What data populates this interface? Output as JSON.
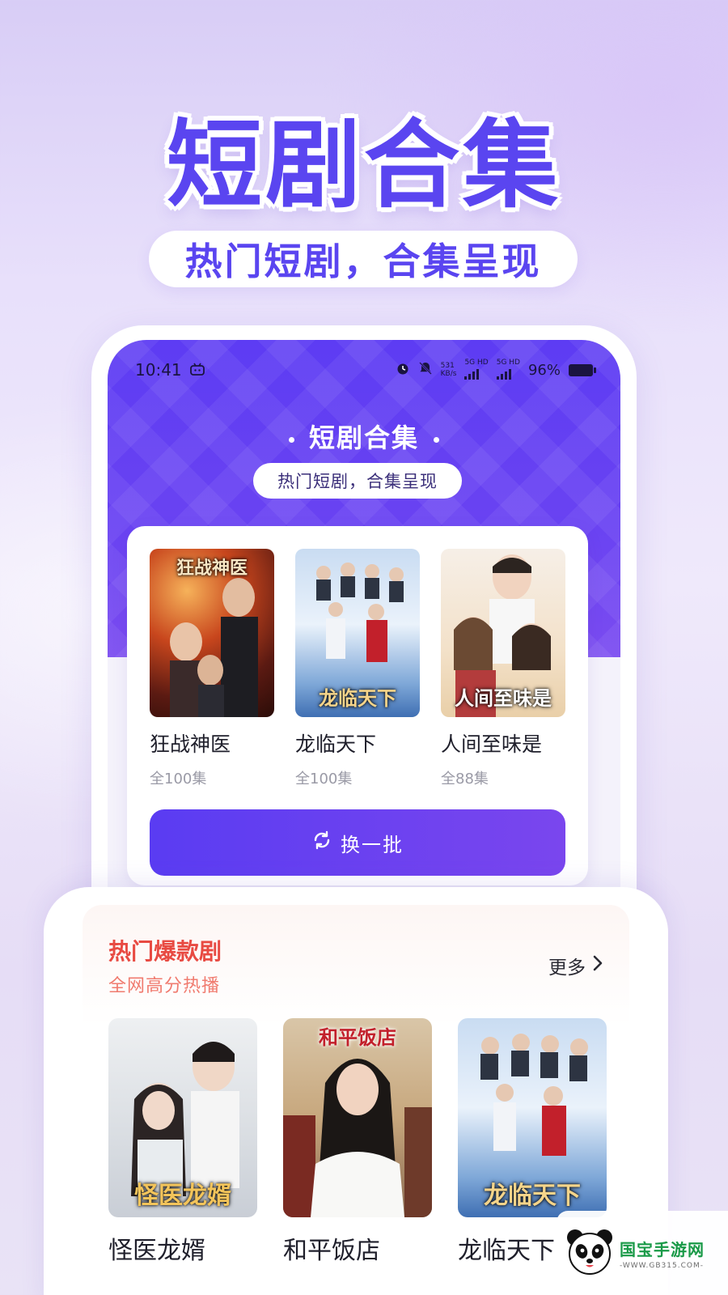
{
  "hero": {
    "title": "短剧合集",
    "subtitle": "热门短剧，合集呈现"
  },
  "status_bar": {
    "time": "10:41",
    "net_speed_value": "531",
    "net_speed_unit": "KB/s",
    "sim1": "5G HD",
    "sim2": "5G HD",
    "battery": "96%"
  },
  "screen": {
    "title": "短剧合集",
    "subtitle": "热门短剧，合集呈现",
    "dramas": [
      {
        "name": "狂战神医",
        "episodes": "全100集",
        "poster_caption": "狂战神医"
      },
      {
        "name": "龙临天下",
        "episodes": "全100集",
        "poster_caption": "龙临天下"
      },
      {
        "name": "人间至味是",
        "episodes": "全88集",
        "poster_caption": "人间至味是"
      }
    ],
    "refresh_label": "换一批"
  },
  "hot": {
    "title": "热门爆款剧",
    "subtitle": "全网高分热播",
    "more_label": "更多",
    "items": [
      {
        "name": "怪医龙婿",
        "poster_caption": "怪医龙婿"
      },
      {
        "name": "和平饭店",
        "poster_caption": "和平饭店"
      },
      {
        "name": "龙临天下",
        "poster_caption": "龙临天下"
      }
    ]
  },
  "watermark": {
    "name": "国宝手游网",
    "url": "-WWW.GB315.COM-"
  },
  "colors": {
    "brand_purple": "#5a45f0",
    "header_gradient_start": "#5d3cf3",
    "header_gradient_end": "#7b4cf0",
    "hot_title_red": "#e84a42",
    "watermark_green": "#1a9a48"
  }
}
